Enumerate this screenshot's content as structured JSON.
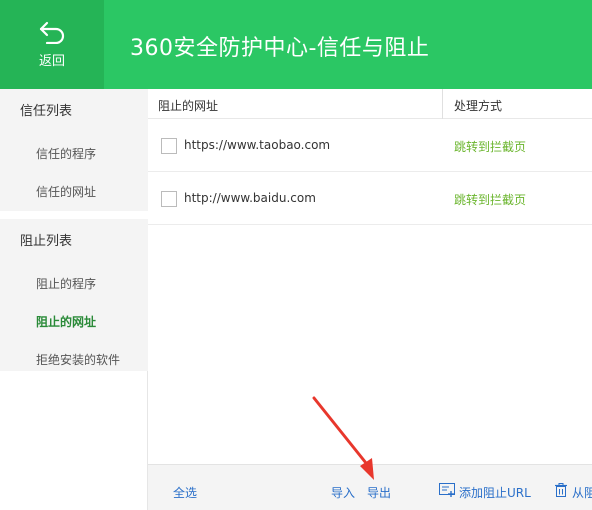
{
  "header": {
    "back_label": "返回",
    "title": "360安全防护中心-信任与阻止",
    "bg_color": "#2bc764",
    "back_bg_color": "#25b456"
  },
  "sidebar": {
    "trust_group": "信任列表",
    "trust_items": [
      "信任的程序",
      "信任的网址"
    ],
    "block_group": "阻止列表",
    "block_items": [
      "阻止的程序",
      "阻止的网址",
      "拒绝安装的软件"
    ],
    "active_item": "阻止的网址"
  },
  "table": {
    "col_url": "阻止的网址",
    "col_action": "处理方式",
    "rows": [
      {
        "url": "https://www.taobao.com",
        "action": "跳转到拦截页"
      },
      {
        "url": "http://www.baidu.com",
        "action": "跳转到拦截页"
      }
    ]
  },
  "footer": {
    "select_all": "全选",
    "import": "导入",
    "export": "导出",
    "add_url": "添加阻止URL",
    "remove_from": "从阻",
    "link_color": "#2a6fc9"
  },
  "icons": [
    "back-arrow-icon",
    "add-list-icon",
    "trash-icon"
  ],
  "annotation": {
    "color": "#e8372c",
    "points_to": "导出"
  }
}
